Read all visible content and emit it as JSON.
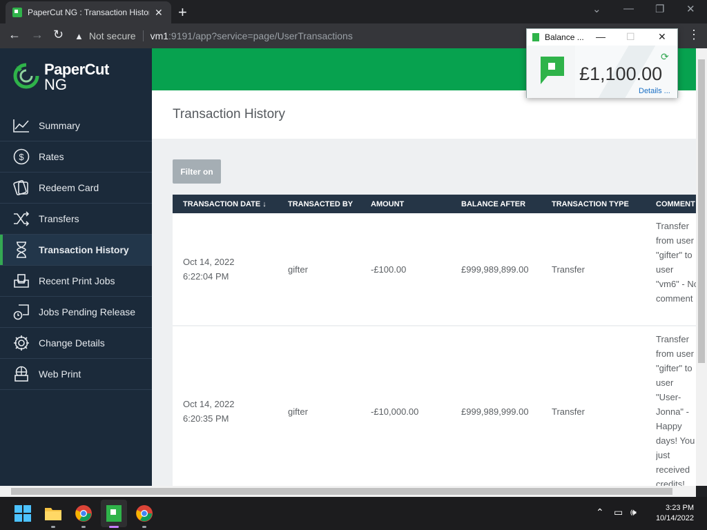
{
  "browser": {
    "tab_title": "PaperCut NG : Transaction History",
    "tab_close": "✕",
    "new_tab": "+",
    "security_label": "Not secure",
    "url_host": "vm1",
    "url_rest": ":9191/app?service=page/UserTransactions"
  },
  "app": {
    "logo_line1": "PaperCut",
    "logo_line2": "NG",
    "page_title": "Transaction History",
    "filter_label": "Filter on"
  },
  "sidebar": {
    "items": [
      {
        "label": "Summary",
        "icon": "chart-icon"
      },
      {
        "label": "Rates",
        "icon": "dollar-icon"
      },
      {
        "label": "Redeem Card",
        "icon": "card-icon"
      },
      {
        "label": "Transfers",
        "icon": "shuffle-icon"
      },
      {
        "label": "Transaction History",
        "icon": "hourglass-icon",
        "active": true
      },
      {
        "label": "Recent Print Jobs",
        "icon": "tray-icon"
      },
      {
        "label": "Jobs Pending Release",
        "icon": "printer-clock-icon"
      },
      {
        "label": "Change Details",
        "icon": "gear-icon"
      },
      {
        "label": "Web Print",
        "icon": "globe-printer-icon"
      }
    ]
  },
  "table": {
    "columns": [
      "TRANSACTION DATE",
      "TRANSACTED BY",
      "AMOUNT",
      "BALANCE AFTER",
      "TRANSACTION TYPE",
      "COMMENT"
    ],
    "sort_indicator": "↓",
    "rows": [
      {
        "date": "Oct 14, 2022",
        "time": "6:22:04 PM",
        "by": "gifter",
        "amount": "-£100.00",
        "balance_after": "£999,989,899.00",
        "type": "Transfer",
        "comment": "Transfer from user \"gifter\" to user \"vm6\" - No comment"
      },
      {
        "date": "Oct 14, 2022",
        "time": "6:20:35 PM",
        "by": "gifter",
        "amount": "-£10,000.00",
        "balance_after": "£999,989,999.00",
        "type": "Transfer",
        "comment": "Transfer from user \"gifter\" to user \"User-Jonna\" - Happy days! You just received credits!"
      }
    ]
  },
  "balance_popup": {
    "title": "Balance ...",
    "amount": "£1,100.00",
    "details_link": "Details ..."
  },
  "taskbar": {
    "time": "3:23 PM",
    "date": "10/14/2022"
  },
  "colors": {
    "brand_green": "#07a24f",
    "sidebar_bg": "#1b2a3a",
    "table_header_bg": "#253546"
  }
}
